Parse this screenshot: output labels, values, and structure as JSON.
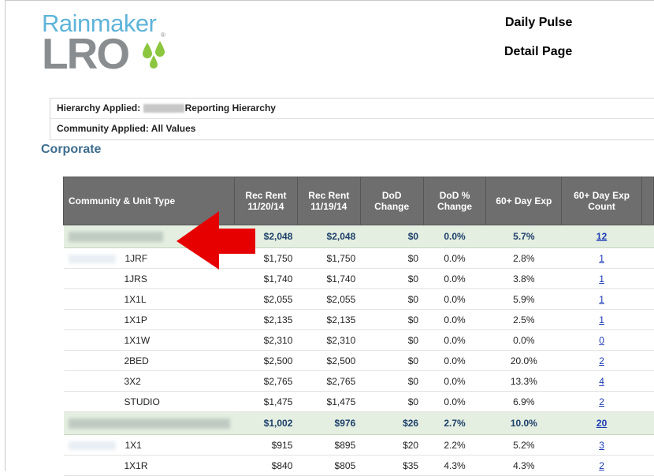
{
  "header": {
    "brand_top": "Rainmaker",
    "brand_main": "LRO",
    "registered": "®",
    "title_line1": "Daily Pulse",
    "title_line2": "Detail Page"
  },
  "filters": {
    "hierarchy_label": "Hierarchy Applied:",
    "hierarchy_value": "Reporting Hierarchy",
    "community_label": "Community Applied:",
    "community_value": "All Values"
  },
  "section_title": "Corporate",
  "table": {
    "columns": [
      "Community & Unit Type",
      "Rec Rent 11/20/14",
      "Rec Rent 11/19/14",
      "DoD Change",
      "DoD % Change",
      "60+ Day Exp",
      "60+ Day Exp Count"
    ],
    "groups": [
      {
        "summary": {
          "rec_rent_1": "$2,048",
          "rec_rent_2": "$2,048",
          "dod_change": "$0",
          "dod_pct": "0.0%",
          "exp60": "5.7%",
          "exp60_count": "12"
        },
        "rows": [
          {
            "unit": "1JRF",
            "rec_rent_1": "$1,750",
            "rec_rent_2": "$1,750",
            "dod_change": "$0",
            "dod_pct": "0.0%",
            "exp60": "2.8%",
            "exp60_count": "1"
          },
          {
            "unit": "1JRS",
            "rec_rent_1": "$1,740",
            "rec_rent_2": "$1,740",
            "dod_change": "$0",
            "dod_pct": "0.0%",
            "exp60": "3.8%",
            "exp60_count": "1"
          },
          {
            "unit": "1X1L",
            "rec_rent_1": "$2,055",
            "rec_rent_2": "$2,055",
            "dod_change": "$0",
            "dod_pct": "0.0%",
            "exp60": "5.9%",
            "exp60_count": "1"
          },
          {
            "unit": "1X1P",
            "rec_rent_1": "$2,135",
            "rec_rent_2": "$2,135",
            "dod_change": "$0",
            "dod_pct": "0.0%",
            "exp60": "2.5%",
            "exp60_count": "1"
          },
          {
            "unit": "1X1W",
            "rec_rent_1": "$2,310",
            "rec_rent_2": "$2,310",
            "dod_change": "$0",
            "dod_pct": "0.0%",
            "exp60": "0.0%",
            "exp60_count": "0"
          },
          {
            "unit": "2BED",
            "rec_rent_1": "$2,500",
            "rec_rent_2": "$2,500",
            "dod_change": "$0",
            "dod_pct": "0.0%",
            "exp60": "20.0%",
            "exp60_count": "2"
          },
          {
            "unit": "3X2",
            "rec_rent_1": "$2,765",
            "rec_rent_2": "$2,765",
            "dod_change": "$0",
            "dod_pct": "0.0%",
            "exp60": "13.3%",
            "exp60_count": "4"
          },
          {
            "unit": "STUDIO",
            "rec_rent_1": "$1,475",
            "rec_rent_2": "$1,475",
            "dod_change": "$0",
            "dod_pct": "0.0%",
            "exp60": "6.9%",
            "exp60_count": "2"
          }
        ]
      },
      {
        "summary": {
          "rec_rent_1": "$1,002",
          "rec_rent_2": "$976",
          "dod_change": "$26",
          "dod_pct": "2.7%",
          "exp60": "10.0%",
          "exp60_count": "20"
        },
        "rows": [
          {
            "unit": "1X1",
            "rec_rent_1": "$915",
            "rec_rent_2": "$895",
            "dod_change": "$20",
            "dod_pct": "2.2%",
            "exp60": "5.2%",
            "exp60_count": "3"
          },
          {
            "unit": "1X1R",
            "rec_rent_1": "$840",
            "rec_rent_2": "$805",
            "dod_change": "$35",
            "dod_pct": "4.3%",
            "exp60": "4.3%",
            "exp60_count": "2"
          }
        ]
      }
    ]
  },
  "colors": {
    "header_bg": "#6e6e6e",
    "group_bg": "#e4efe1",
    "link": "#1a39b5",
    "section_title": "#3e6d8e",
    "annotation_arrow": "#e60000"
  }
}
